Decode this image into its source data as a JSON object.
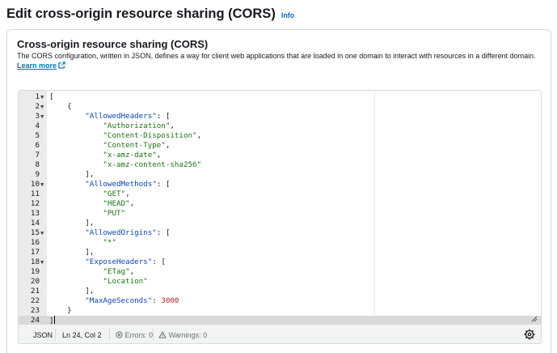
{
  "page": {
    "title": "Edit cross-origin resource sharing (CORS)",
    "info_link": "Info"
  },
  "panel": {
    "title": "Cross-origin resource sharing (CORS)",
    "description": "The CORS configuration, written in JSON, defines a way for client web applications that are loaded in one domain to interact with resources in a different domain.",
    "learn_more": "Learn more"
  },
  "editor": {
    "lines": [
      {
        "n": "1",
        "fold": true
      },
      {
        "n": "2",
        "fold": true
      },
      {
        "n": "3",
        "fold": true
      },
      {
        "n": "4",
        "fold": false
      },
      {
        "n": "5",
        "fold": false
      },
      {
        "n": "6",
        "fold": false
      },
      {
        "n": "7",
        "fold": false
      },
      {
        "n": "8",
        "fold": false
      },
      {
        "n": "9",
        "fold": false
      },
      {
        "n": "10",
        "fold": true
      },
      {
        "n": "11",
        "fold": false
      },
      {
        "n": "12",
        "fold": false
      },
      {
        "n": "13",
        "fold": false
      },
      {
        "n": "14",
        "fold": false
      },
      {
        "n": "15",
        "fold": true
      },
      {
        "n": "16",
        "fold": false
      },
      {
        "n": "17",
        "fold": false
      },
      {
        "n": "18",
        "fold": true
      },
      {
        "n": "19",
        "fold": false
      },
      {
        "n": "20",
        "fold": false
      },
      {
        "n": "21",
        "fold": false
      },
      {
        "n": "22",
        "fold": false
      },
      {
        "n": "23",
        "fold": false
      },
      {
        "n": "24",
        "fold": false
      }
    ],
    "active_line": "24",
    "code": {
      "open_bracket": "[",
      "open_brace": "{",
      "key_allowed_headers": "\"AllowedHeaders\"",
      "h1": "\"Authorization\"",
      "h2": "\"Content-Disposition\"",
      "h3": "\"Content-Type\"",
      "h4": "\"x-amz-date\"",
      "h5": "\"x-amz-content-sha256\"",
      "key_allowed_methods": "\"AllowedMethods\"",
      "m1": "\"GET\"",
      "m2": "\"HEAD\"",
      "m3": "\"PUT\"",
      "key_allowed_origins": "\"AllowedOrigins\"",
      "o1": "\"*\"",
      "key_expose_headers": "\"ExposeHeaders\"",
      "e1": "\"ETag\"",
      "e2": "\"Location\"",
      "key_max_age": "\"MaxAgeSeconds\"",
      "max_age_value": "3000",
      "close_brace": "}",
      "close_bracket": "]"
    }
  },
  "status_bar": {
    "language": "JSON",
    "position": "Ln 24, Col 2",
    "errors": "Errors: 0",
    "warnings": "Warnings: 0"
  },
  "icons": {
    "info": "info-link",
    "external": "external-link-icon",
    "error": "error-icon",
    "warning": "warning-icon",
    "settings": "gear-icon",
    "fold": "fold-arrow-icon",
    "resize": "resize-handle-icon"
  },
  "colors": {
    "link": "#0073bb",
    "key": "#0b46b0",
    "string": "#1a7413",
    "number": "#aa2220"
  }
}
